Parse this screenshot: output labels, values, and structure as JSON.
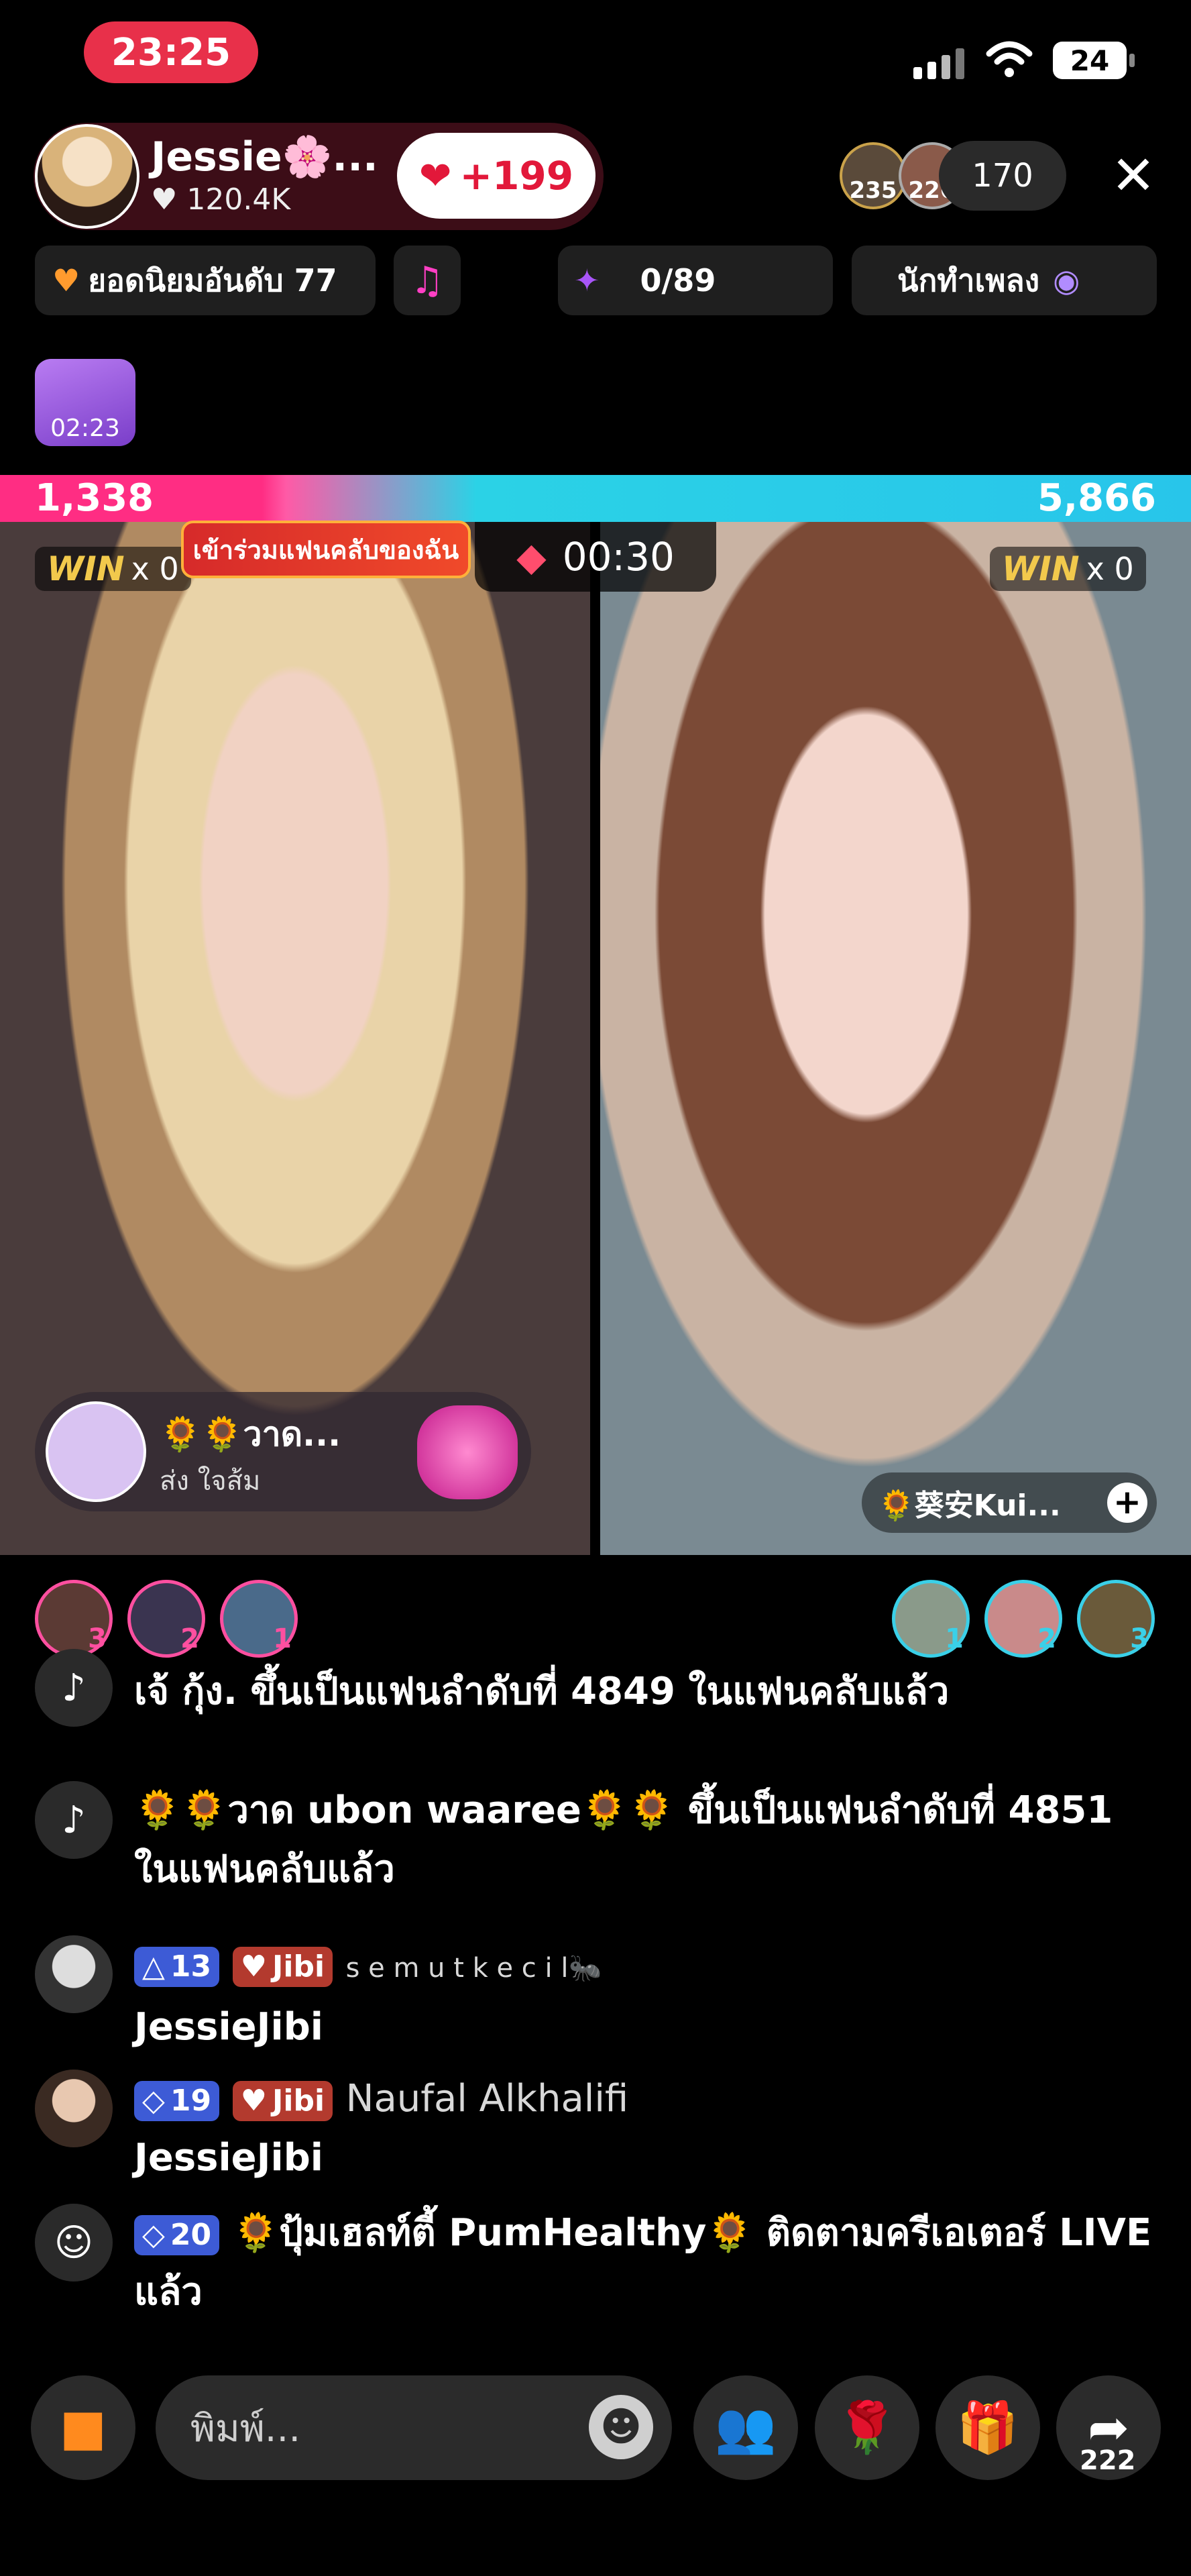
{
  "status_bar": {
    "time": "23:25",
    "battery": "24"
  },
  "host": {
    "name": "Jessie🌸...",
    "likes": "♥ 120.4K",
    "like_button": "+199"
  },
  "viewers": {
    "avatar1_count": "235",
    "avatar2_count": "226",
    "total": "170"
  },
  "chips": {
    "rank": "ยอดนิยมอันดับ 77",
    "progress": "0/89",
    "music": "นักทำเพลง"
  },
  "timer_gift": "02:23",
  "battle": {
    "score_left": "1,338",
    "score_right": "5,866",
    "timer": "00:30",
    "win_left_label": "WIN",
    "win_left_value": "x 0",
    "win_right_label": "WIN",
    "win_right_value": "x 0",
    "fan_banner": "เข้าร่วมแฟนคลับของฉัน",
    "gift_toast": {
      "name": "🌻🌻วาด...",
      "action": "ส่ง ใจส้ม"
    },
    "guest_tag": "🌻葵安Kui..."
  },
  "top_gifters_left": [
    "3",
    "2",
    "1"
  ],
  "top_gifters_right": [
    "1",
    "2",
    "3"
  ],
  "chat": [
    {
      "text": "เจ้ กุ้ง. ขึ้นเป็นแฟนลำดับที่ 4849 ในแฟนคลับแล้ว"
    },
    {
      "text": "🌻🌻วาด ubon waaree🌻🌻 ขึ้นเป็นแฟนลำดับที่ 4851 ในแฟนคลับแล้ว"
    },
    {
      "level": "13",
      "fan": "Jibi",
      "user": "s e m u t  k e c i l🐜",
      "message": "JessieJibi"
    },
    {
      "level": "19",
      "fan": "Jibi",
      "user": "Naufal Alkhalifi",
      "message": "JessieJibi"
    },
    {
      "level": "20",
      "text": "🌻ปุ้มเฮลท์ตี้ PumHealthy🌻 ติดตามครีเอเตอร์ LIVE แล้ว"
    }
  ],
  "input": {
    "placeholder": "พิมพ์..."
  },
  "share_count": "222"
}
